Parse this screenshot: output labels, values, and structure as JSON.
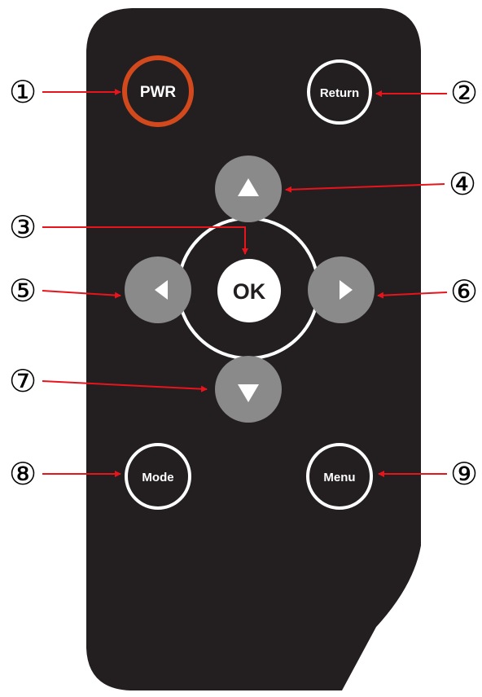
{
  "remote": {
    "body_color": "#231f20",
    "arrow_color": "#e8141c",
    "pwr_ring_color": "#d2491d",
    "dpad_color": "#8a8a8a"
  },
  "buttons": {
    "power": "PWR",
    "return": "Return",
    "ok": "OK",
    "mode": "Mode",
    "menu": "Menu"
  },
  "callouts": {
    "c1": "①",
    "c2": "②",
    "c3": "③",
    "c4": "④",
    "c5": "⑤",
    "c6": "⑥",
    "c7": "⑦",
    "c8": "⑧",
    "c9": "⑨"
  },
  "icons": {
    "up": "triangle-up-icon",
    "down": "triangle-down-icon",
    "left": "triangle-left-icon",
    "right": "triangle-right-icon"
  }
}
